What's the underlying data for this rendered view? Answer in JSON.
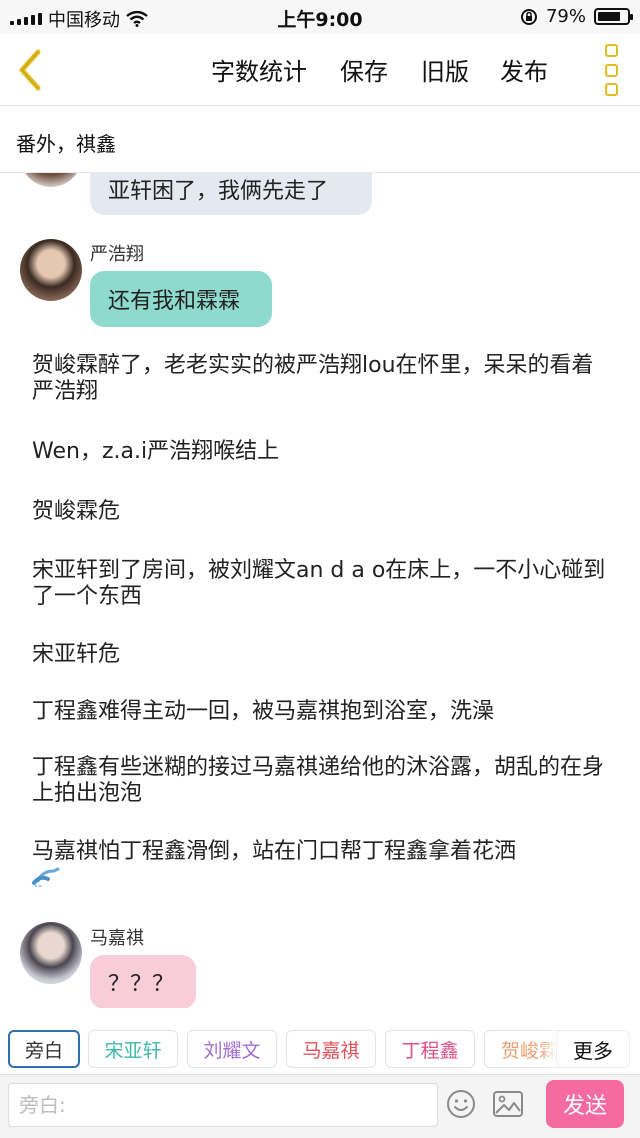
{
  "status_bar": {
    "carrier": "中国移动",
    "time": "上午9:00",
    "battery": "79%",
    "battery_level": 0.79
  },
  "nav": {
    "back_icon": "chevron-left-icon",
    "word_count": "字数统计",
    "save": "保存",
    "old_version": "旧版",
    "publish": "发布",
    "more_icon": "vertical-dots-icon",
    "accent_color": "#e1bd22"
  },
  "chapter": {
    "title": "番外，祺鑫"
  },
  "messages": [
    {
      "speaker": "",
      "text": "亚轩困了，我俩先走了",
      "bubble_color": "#e4e9f1"
    },
    {
      "speaker": "严浩翔",
      "text": "还有我和霖霖",
      "bubble_color": "#8fdacf"
    },
    {
      "speaker": "马嘉祺",
      "text": "？？？",
      "bubble_color": "#f9ccd9"
    }
  ],
  "narration": [
    "贺峻霖醉了，老老实实的被严浩翔lou在怀里，呆呆的看着严浩翔",
    "Wen，z.a.i严浩翔喉结上",
    "贺峻霖危",
    "宋亚轩到了房间，被刘耀文an d a o在床上，一不小心碰到了一个东西",
    "宋亚轩危",
    "丁程鑫难得主动一回，被马嘉祺抱到浴室，洗澡",
    "丁程鑫有些迷糊的接过马嘉祺递给他的沐浴露，胡乱的在身上拍出泡泡",
    "马嘉祺怕丁程鑫滑倒，站在门口帮丁程鑫拿着花洒"
  ],
  "shower_icon": "shower-head-icon",
  "roles": [
    {
      "label": "旁白",
      "color": "#333333",
      "selected": true
    },
    {
      "label": "宋亚轩",
      "color": "#3fb9a8",
      "selected": false
    },
    {
      "label": "刘耀文",
      "color": "#a26fd1",
      "selected": false
    },
    {
      "label": "马嘉祺",
      "color": "#e0525a",
      "selected": false
    },
    {
      "label": "丁程鑫",
      "color": "#e2508a",
      "selected": false
    },
    {
      "label": "贺峻霖",
      "color": "#e8a070",
      "selected": false
    }
  ],
  "more_roles": "更多",
  "input": {
    "placeholder": "旁白:",
    "emoji_icon": "smiley-icon",
    "image_icon": "image-icon",
    "send": "发送",
    "send_color": "#f56aa0"
  }
}
